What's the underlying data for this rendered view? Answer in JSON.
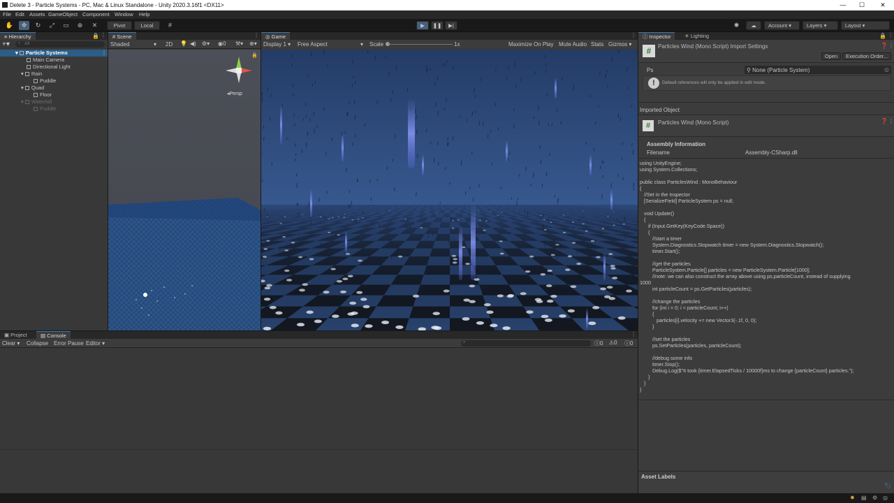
{
  "window": {
    "title": "Delete 3 - Particle Systems - PC, Mac & Linux Standalone - Unity 2020.3.16f1 <DX11>",
    "minimize": "—",
    "maximize": "☐",
    "close": "✕"
  },
  "menu": [
    "File",
    "Edit",
    "Assets",
    "GameObject",
    "Component",
    "Window",
    "Help"
  ],
  "toolbar": {
    "pivot": "Pivot",
    "local": "Local",
    "account": "Account",
    "layers": "Layers",
    "layout": "Layout"
  },
  "hierarchy": {
    "tab": "Hierarchy",
    "search_placeholder": "All",
    "items": [
      {
        "label": "Particle Systems",
        "depth": 0
      },
      {
        "label": "Main Camera",
        "depth": 1
      },
      {
        "label": "Directional Light",
        "depth": 1
      },
      {
        "label": "Rain",
        "depth": 1
      },
      {
        "label": "Puddle",
        "depth": 2
      },
      {
        "label": "Quad",
        "depth": 1
      },
      {
        "label": "Floor",
        "depth": 2
      },
      {
        "label": "Waterfall",
        "depth": 1
      },
      {
        "label": "Puddle",
        "depth": 2
      }
    ]
  },
  "scene": {
    "tab": "Scene",
    "shading": "Shaded",
    "mode2d": "2D",
    "gizmo_label": "Persp"
  },
  "game": {
    "tab": "Game",
    "display": "Display 1",
    "aspect": "Free Aspect",
    "scale_label": "Scale",
    "scale_value": "1x",
    "maximize": "Maximize On Play",
    "mute": "Mute Audio",
    "stats": "Stats",
    "gizmos": "Gizmos"
  },
  "console": {
    "tab_project": "Project",
    "tab_console": "Console",
    "clear": "Clear",
    "collapse": "Collapse",
    "error_pause": "Error Pause",
    "editor": "Editor",
    "count_log": "0",
    "count_warn": "0",
    "count_error": "0"
  },
  "inspector": {
    "tab_inspector": "Inspector",
    "tab_lighting": "Lighting",
    "header_title": "Particles Wind (Mono Script) Import Settings",
    "open": "Open",
    "execution_order": "Execution Order...",
    "field_label": "Ps",
    "field_value": "None (Particle System)",
    "help": "Default references will only be applied in edit mode.",
    "imported_object": "Imported Object",
    "object_title": "Particles Wind (Mono Script)",
    "assembly_header": "Assembly Information",
    "filename_label": "Filename",
    "filename_value": "Assembly-CSharp.dll",
    "code": "using UnityEngine;\nusing System.Collections;\n\npublic class ParticlesWind : MonoBehaviour\n{\n   //Set in the Inspector\n   [SerializeField] ParticleSystem ps = null;\n\n   void Update()\n   {\n      if (Input.GetKey(KeyCode.Space))\n      {\n         //start a timer\n         System.Diagnostics.Stopwatch timer = new System.Diagnostics.Stopwatch();\n         timer.Start();\n\n         //get the particles\n         ParticleSystem.Particle[] particles = new ParticleSystem.Particle[1000];\n         //note: we can also construct the array above using ps.particleCount, instead of supplying\n1000\n         int particleCount = ps.GetParticles(particles);\n\n         //change the particles\n         for (int i = 0; i < particleCount; i++)\n         {\n            particles[i].velocity += new Vector3(-.1f, 0, 0);\n         }\n\n         //set the particles\n         ps.SetParticles(particles, particleCount);\n\n         //debug some info\n         timer.Stop();\n         Debug.Log($\"It took {timer.ElapsedTicks / 10000f}ms to change {particleCount} particles.\");\n      }\n   }\n}",
    "asset_labels": "Asset Labels"
  }
}
